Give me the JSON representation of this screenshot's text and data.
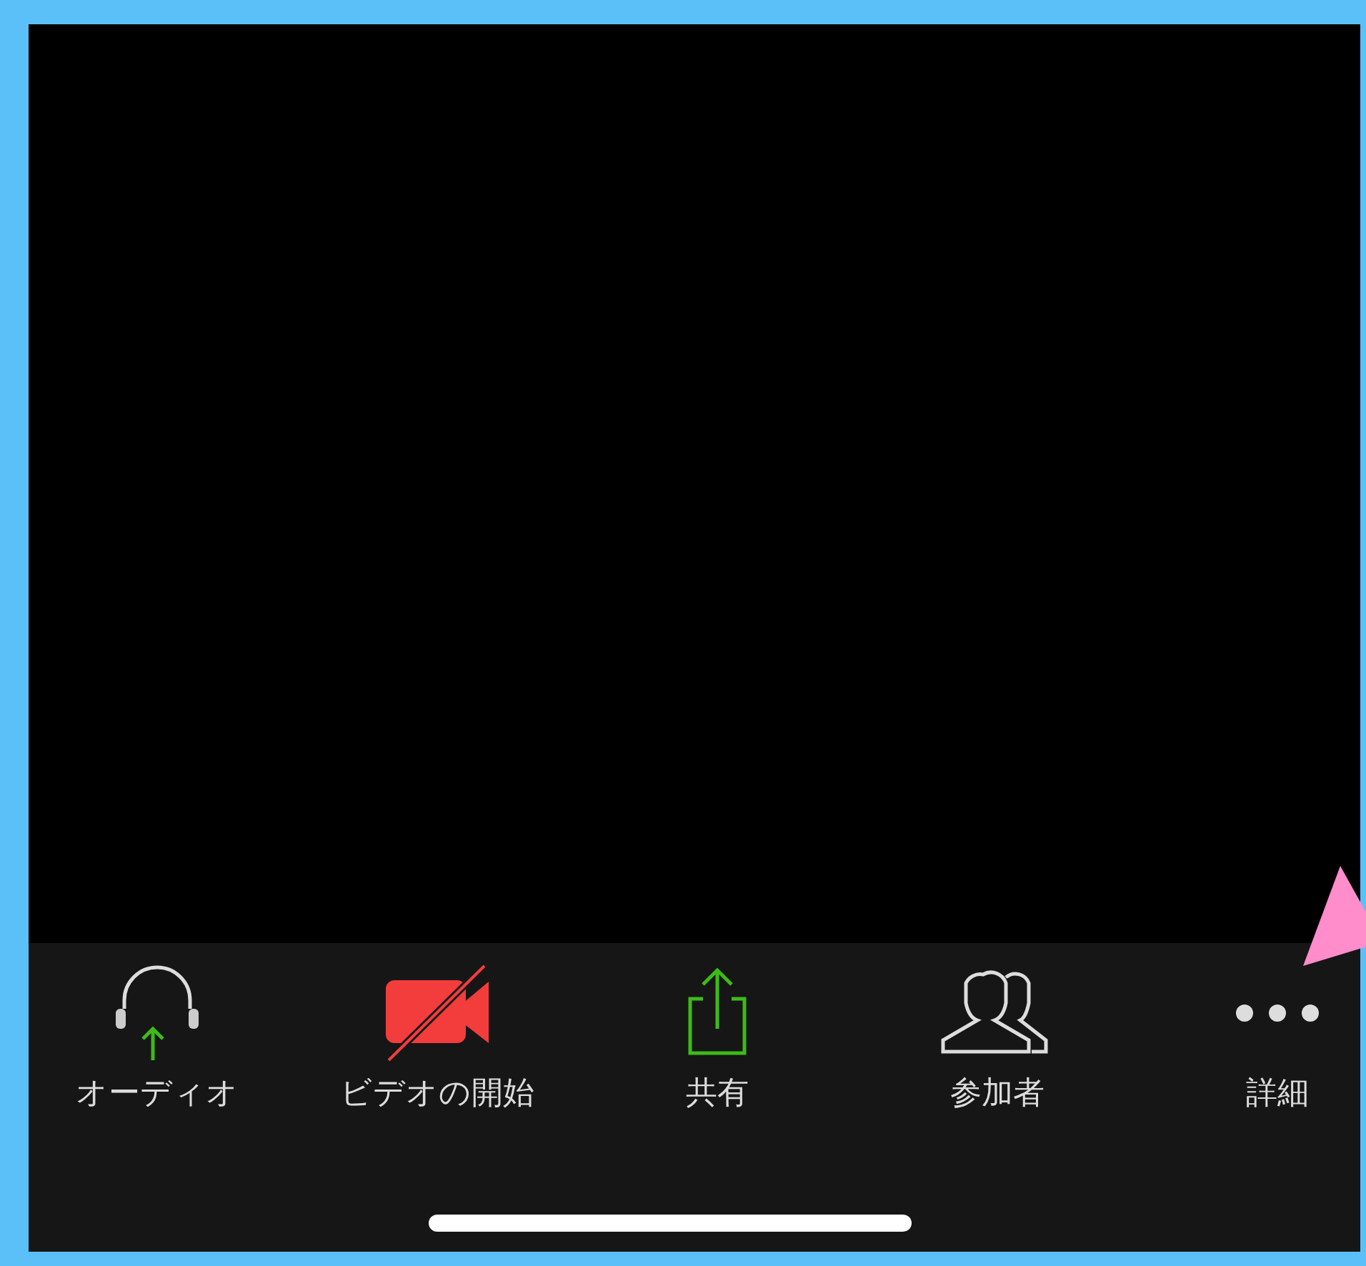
{
  "toolbar": {
    "items": [
      {
        "kind": "audio",
        "label": "オーディオ"
      },
      {
        "kind": "video",
        "label": "ビデオの開始"
      },
      {
        "kind": "share",
        "label": "共有"
      },
      {
        "kind": "participants",
        "label": "参加者"
      },
      {
        "kind": "more",
        "label": "詳細"
      }
    ]
  }
}
